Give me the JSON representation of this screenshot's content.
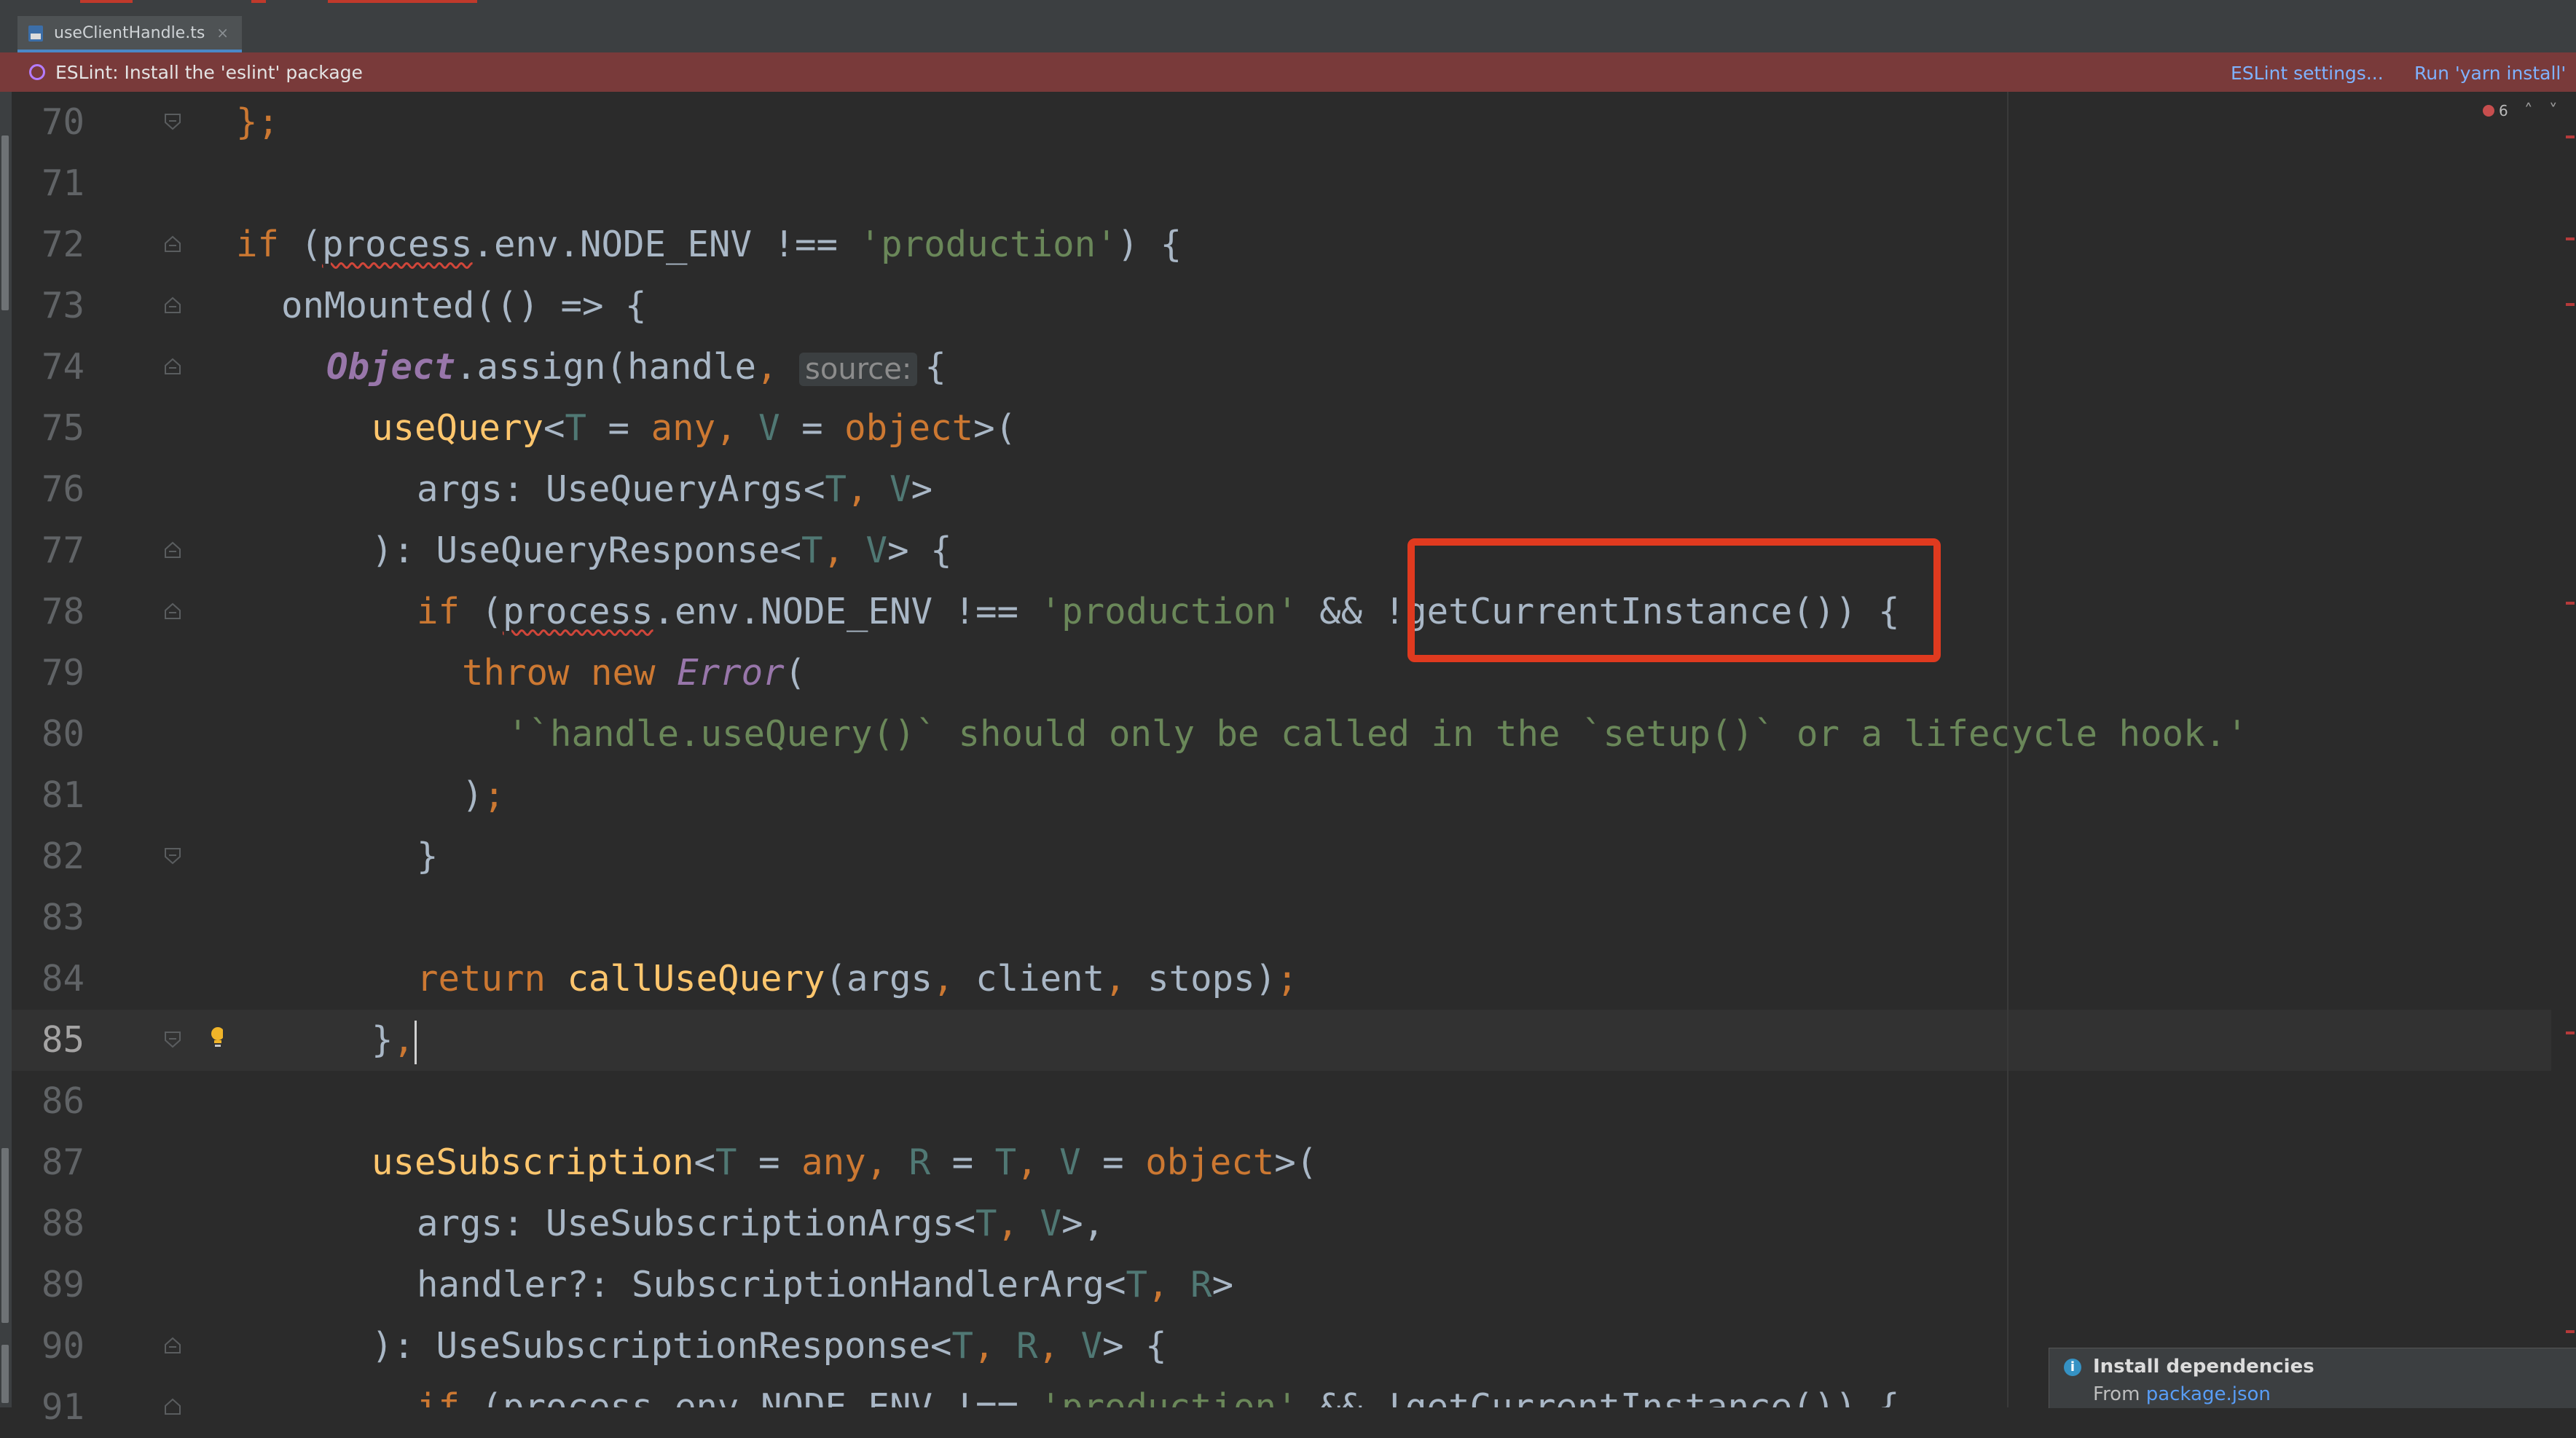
{
  "tab": {
    "label": "useClientHandle.ts",
    "close": "×"
  },
  "eslint_bar": {
    "message": "ESLint: Install the 'eslint' package",
    "settings_link": "ESLint settings...",
    "run_link": "Run 'yarn install'"
  },
  "problems": {
    "count": "6"
  },
  "editor": {
    "current_line": "85",
    "lines": [
      {
        "n": "70"
      },
      {
        "n": "71"
      },
      {
        "n": "72"
      },
      {
        "n": "73"
      },
      {
        "n": "74"
      },
      {
        "n": "75"
      },
      {
        "n": "76"
      },
      {
        "n": "77"
      },
      {
        "n": "78"
      },
      {
        "n": "79"
      },
      {
        "n": "80"
      },
      {
        "n": "81"
      },
      {
        "n": "82"
      },
      {
        "n": "83"
      },
      {
        "n": "84"
      },
      {
        "n": "85"
      },
      {
        "n": "86"
      },
      {
        "n": "87"
      },
      {
        "n": "88"
      },
      {
        "n": "89"
      },
      {
        "n": "90"
      },
      {
        "n": "91"
      }
    ],
    "tokens": {
      "l70a": "};",
      "l72a": "if",
      "l72b": " (",
      "l72c": "process",
      "l72d": ".env.NODE_ENV !== ",
      "l72e": "'production'",
      "l72f": ") {",
      "l73a": "onMounted",
      "l73b": "(() => {",
      "l74a": "Object",
      "l74b": ".assign(handle",
      "l74c": ", ",
      "l74hint": "source:",
      "l74d": "{",
      "l75a": "useQuery",
      "l75b": "<",
      "l75c": "T",
      "l75d": " = ",
      "l75e": "any",
      "l75f": ", ",
      "l75g": "V",
      "l75h": " = ",
      "l75i": "object",
      "l75j": ">(",
      "l76a": "args: UseQueryArgs<",
      "l76b": "T",
      "l76c": ", ",
      "l76d": "V",
      "l76e": ">",
      "l77a": "): UseQueryResponse<",
      "l77b": "T",
      "l77c": ", ",
      "l77d": "V",
      "l77e": "> {",
      "l78a": "if",
      "l78b": " (",
      "l78c": "process",
      "l78d": ".env.NODE_ENV !== ",
      "l78e": "'production'",
      "l78f": " && !getCurrentInstance()) {",
      "l79a": "throw",
      "l79b": " ",
      "l79c": "new",
      "l79d": " ",
      "l79e": "Error",
      "l79f": "(",
      "l80a": "'`handle.useQuery()` should only be called in the `setup()` or a lifecycle hook.'",
      "l81a": ")",
      "l81b": ";",
      "l82a": "}",
      "l84a": "return",
      "l84b": " ",
      "l84c": "callUseQuery",
      "l84d": "(args",
      "l84e": ", ",
      "l84f": "client",
      "l84g": ", ",
      "l84h": "stops)",
      "l84i": ";",
      "l85a": "}",
      "l85b": ",",
      "l87a": "useSubscription",
      "l87b": "<",
      "l87c": "T",
      "l87d": " = ",
      "l87e": "any",
      "l87f": ", ",
      "l87g": "R",
      "l87h": " = ",
      "l87i": "T",
      "l87j": ", ",
      "l87k": "V",
      "l87l": " = ",
      "l87m": "object",
      "l87n": ">(",
      "l88a": "args: UseSubscriptionArgs<",
      "l88b": "T",
      "l88c": ", ",
      "l88d": "V",
      "l88e": ">,",
      "l89a": "handler?: SubscriptionHandlerArg<",
      "l89b": "T",
      "l89c": ", ",
      "l89d": "R",
      "l89e": ">",
      "l90a": "): UseSubscriptionResponse<",
      "l90b": "T",
      "l90c": ", ",
      "l90d": "R",
      "l90e": ", ",
      "l90f": "V",
      "l90g": "> {",
      "l91a": "if",
      "l91b": " (process.env.NODE_ENV !== ",
      "l91c": "'production'",
      "l91d": " && !getCurrentInstance()) {"
    }
  },
  "notification": {
    "title": "Install dependencies",
    "from_label": "From",
    "from_link": "package.json"
  },
  "colors": {
    "editor_bg": "#2b2b2b",
    "keyword": "#cc7832",
    "string": "#6a8759",
    "function": "#ffc66d",
    "highlight_box": "#e03a1f",
    "eslint_bar": "#793a3a"
  }
}
